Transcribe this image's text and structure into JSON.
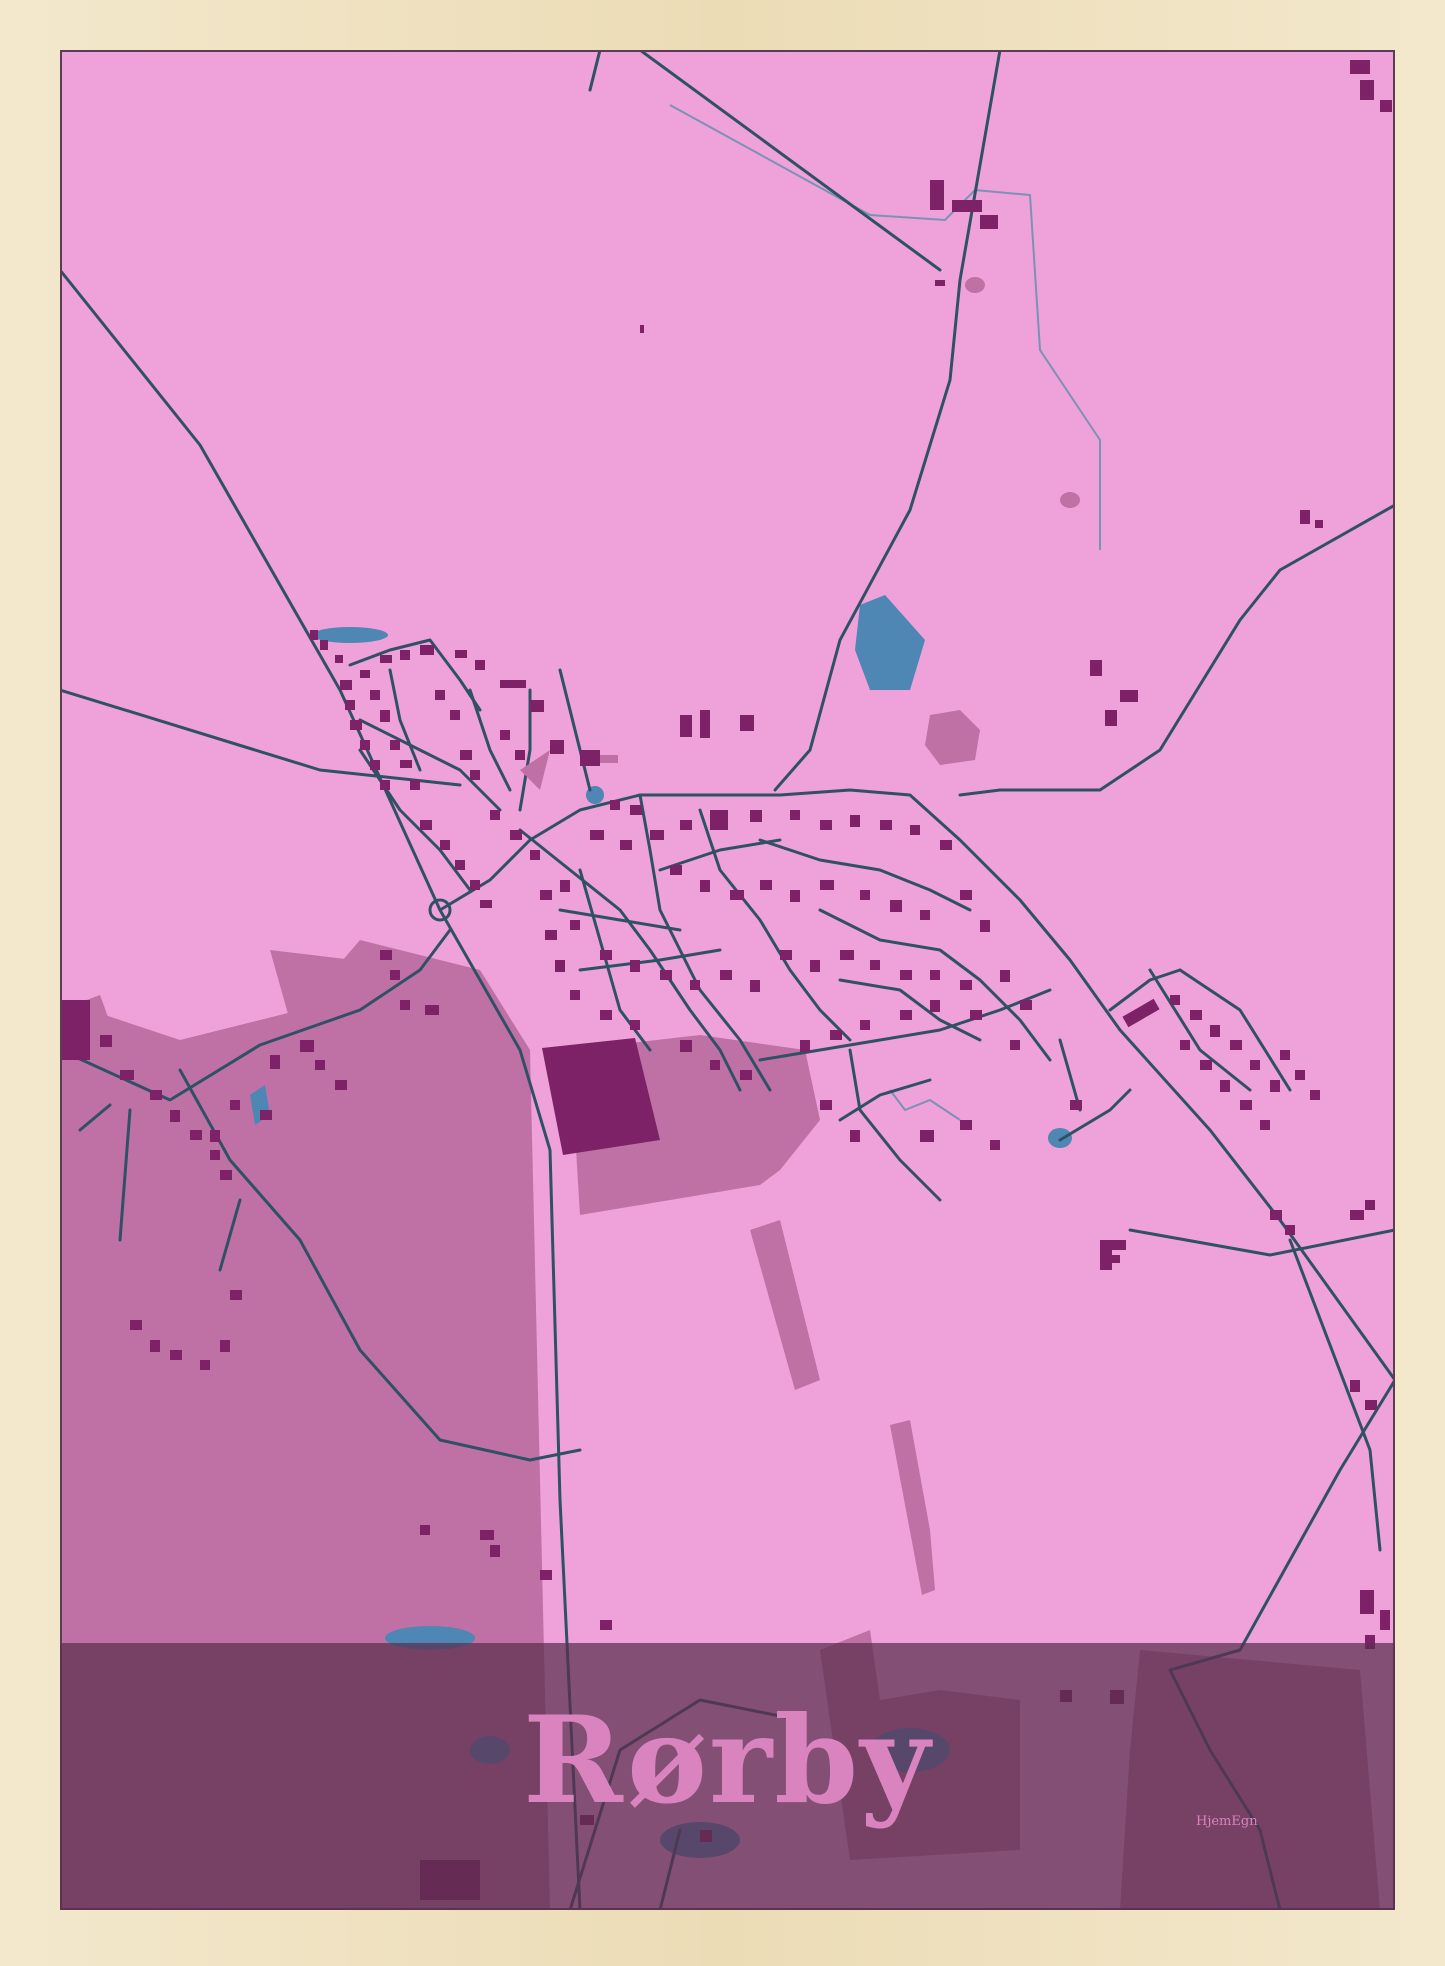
{
  "poster": {
    "town_name": "Rørby",
    "maker_mark": "HjemEgn"
  },
  "colors": {
    "frame": "#f0e3c2",
    "land": "#eea2d9",
    "fields": "#bf71a6",
    "buildings": "#7d2266",
    "roads": "#2f5065",
    "water": "#4e86b4",
    "title_band": "#5b2f4e",
    "title_text": "#d983bf"
  },
  "map": {
    "features": [
      "roads",
      "buildings",
      "fields",
      "lakes",
      "roundabout"
    ]
  }
}
